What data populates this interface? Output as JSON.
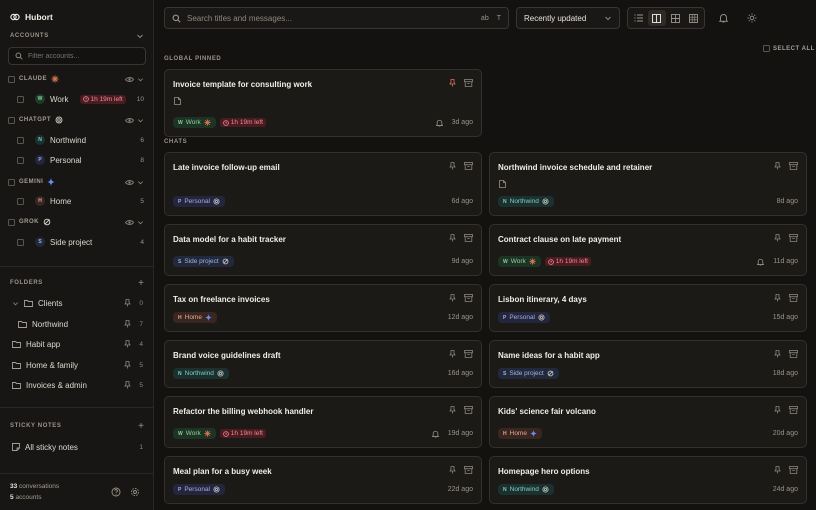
{
  "app": {
    "name": "Hubort"
  },
  "sidebar": {
    "accounts_label": "ACCOUNTS",
    "filter_placeholder": "Filter accounts...",
    "accounts": [
      {
        "name": "CLAUDE",
        "brand_icon": "claude-star-icon",
        "brand_color": "#d9774f",
        "subaccounts": [
          {
            "name": "Work",
            "initial": "W",
            "timer": "1h 19m left",
            "count": "10"
          }
        ]
      },
      {
        "name": "CHATGPT",
        "brand_icon": "openai-knot-icon",
        "brand_color": "#cfcac2",
        "subaccounts": [
          {
            "name": "Northwind",
            "initial": "N",
            "count": "6"
          },
          {
            "name": "Personal",
            "initial": "P",
            "count": "8"
          }
        ]
      },
      {
        "name": "GEMINI",
        "brand_icon": "gemini-sparkle-icon",
        "brand_color": "#6a8ff0",
        "subaccounts": [
          {
            "name": "Home",
            "initial": "H",
            "count": "5"
          }
        ]
      },
      {
        "name": "GROK",
        "brand_icon": "grok-ring-icon",
        "brand_color": "#cfcac2",
        "subaccounts": [
          {
            "name": "Side project",
            "initial": "S",
            "count": "4"
          }
        ]
      }
    ],
    "folders_label": "FOLDERS",
    "folders": [
      {
        "name": "Clients",
        "count": "0",
        "level": 0,
        "expanded": true
      },
      {
        "name": "Northwind",
        "count": "7",
        "level": 1
      },
      {
        "name": "Habit app",
        "count": "4",
        "level": 0
      },
      {
        "name": "Home & family",
        "count": "5",
        "level": 0
      },
      {
        "name": "Invoices & admin",
        "count": "5",
        "level": 0
      }
    ],
    "sticky_label": "STICKY NOTES",
    "sticky_items": [
      {
        "name": "All sticky notes",
        "count": "1"
      }
    ],
    "footer": {
      "conversations_count": "33",
      "conversations_label": "conversations",
      "accounts_count": "5",
      "accounts_label": "accounts"
    }
  },
  "toolbar": {
    "search_placeholder": "Search titles and messages...",
    "flag_case": "ab",
    "flag_title": "T",
    "sort_value": "Recently updated"
  },
  "content": {
    "select_all": "SELECT ALL",
    "pinned_label": "GLOBAL PINNED",
    "chats_label": "CHATS",
    "pinned": [
      {
        "title": "Invoice template for consulting work",
        "doc": true,
        "tag": "Work",
        "tag_kind": "work",
        "timer": "1h 19m left",
        "bell": true,
        "time": "3d ago"
      }
    ],
    "chats": [
      {
        "title": "Late invoice follow-up email",
        "tag": "Personal",
        "tag_kind": "personal",
        "time": "6d ago"
      },
      {
        "title": "Northwind invoice schedule and retainer",
        "doc": true,
        "tag": "Northwind",
        "tag_kind": "northwind",
        "time": "8d ago"
      },
      {
        "title": "Data model for a habit tracker",
        "tag": "Side project",
        "tag_kind": "side",
        "time": "9d ago"
      },
      {
        "title": "Contract clause on late payment",
        "tag": "Work",
        "tag_kind": "work",
        "timer": "1h 19m left",
        "bell": true,
        "time": "11d ago"
      },
      {
        "title": "Tax on freelance invoices",
        "tag": "Home",
        "tag_kind": "home",
        "time": "12d ago"
      },
      {
        "title": "Lisbon itinerary, 4 days",
        "tag": "Personal",
        "tag_kind": "personal",
        "time": "15d ago"
      },
      {
        "title": "Brand voice guidelines draft",
        "tag": "Northwind",
        "tag_kind": "northwind",
        "time": "16d ago"
      },
      {
        "title": "Name ideas for a habit app",
        "tag": "Side project",
        "tag_kind": "side",
        "time": "18d ago"
      },
      {
        "title": "Refactor the billing webhook handler",
        "tag": "Work",
        "tag_kind": "work",
        "timer": "1h 19m left",
        "bell": true,
        "time": "19d ago"
      },
      {
        "title": "Kids' science fair volcano",
        "tag": "Home",
        "tag_kind": "home",
        "time": "20d ago"
      },
      {
        "title": "Meal plan for a busy week",
        "tag": "Personal",
        "tag_kind": "personal",
        "time": "22d ago"
      },
      {
        "title": "Homepage hero options",
        "tag": "Northwind",
        "tag_kind": "northwind",
        "time": "24d ago"
      }
    ]
  }
}
